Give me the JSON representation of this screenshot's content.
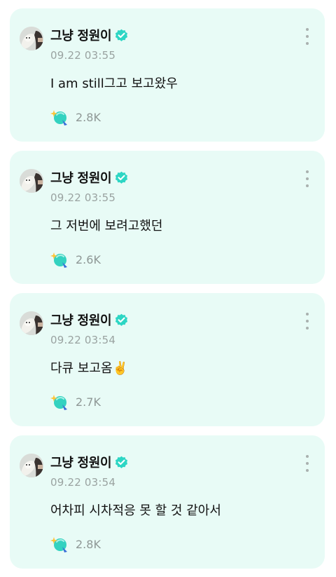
{
  "posts": [
    {
      "author": "그냥 정원이",
      "timestamp": "09.22 03:55",
      "text": "I am still그고 보고왔우",
      "reaction_count": "2.8K",
      "avatar_icon": "alpaca-avatar-icon",
      "verified_icon": "verified-badge-icon"
    },
    {
      "author": "그냥 정원이",
      "timestamp": "09.22 03:55",
      "text": "그 저번에 보려고했던",
      "reaction_count": "2.6K",
      "avatar_icon": "alpaca-avatar-icon",
      "verified_icon": "verified-badge-icon"
    },
    {
      "author": "그냥 정원이",
      "timestamp": "09.22 03:54",
      "text": "다큐 보고옴✌️",
      "reaction_count": "2.7K",
      "avatar_icon": "alpaca-avatar-icon",
      "verified_icon": "verified-badge-icon"
    },
    {
      "author": "그냥 정원이",
      "timestamp": "09.22 03:54",
      "text": "어차피 시차적응 못 할 것 같아서",
      "reaction_count": "2.8K",
      "avatar_icon": "alpaca-avatar-icon",
      "verified_icon": "verified-badge-icon"
    }
  ],
  "colors": {
    "card_background": "#e8fbf6",
    "verified_badge": "#2dd6c4",
    "timestamp": "#9aa3a1",
    "reaction_count": "#8f9896"
  }
}
